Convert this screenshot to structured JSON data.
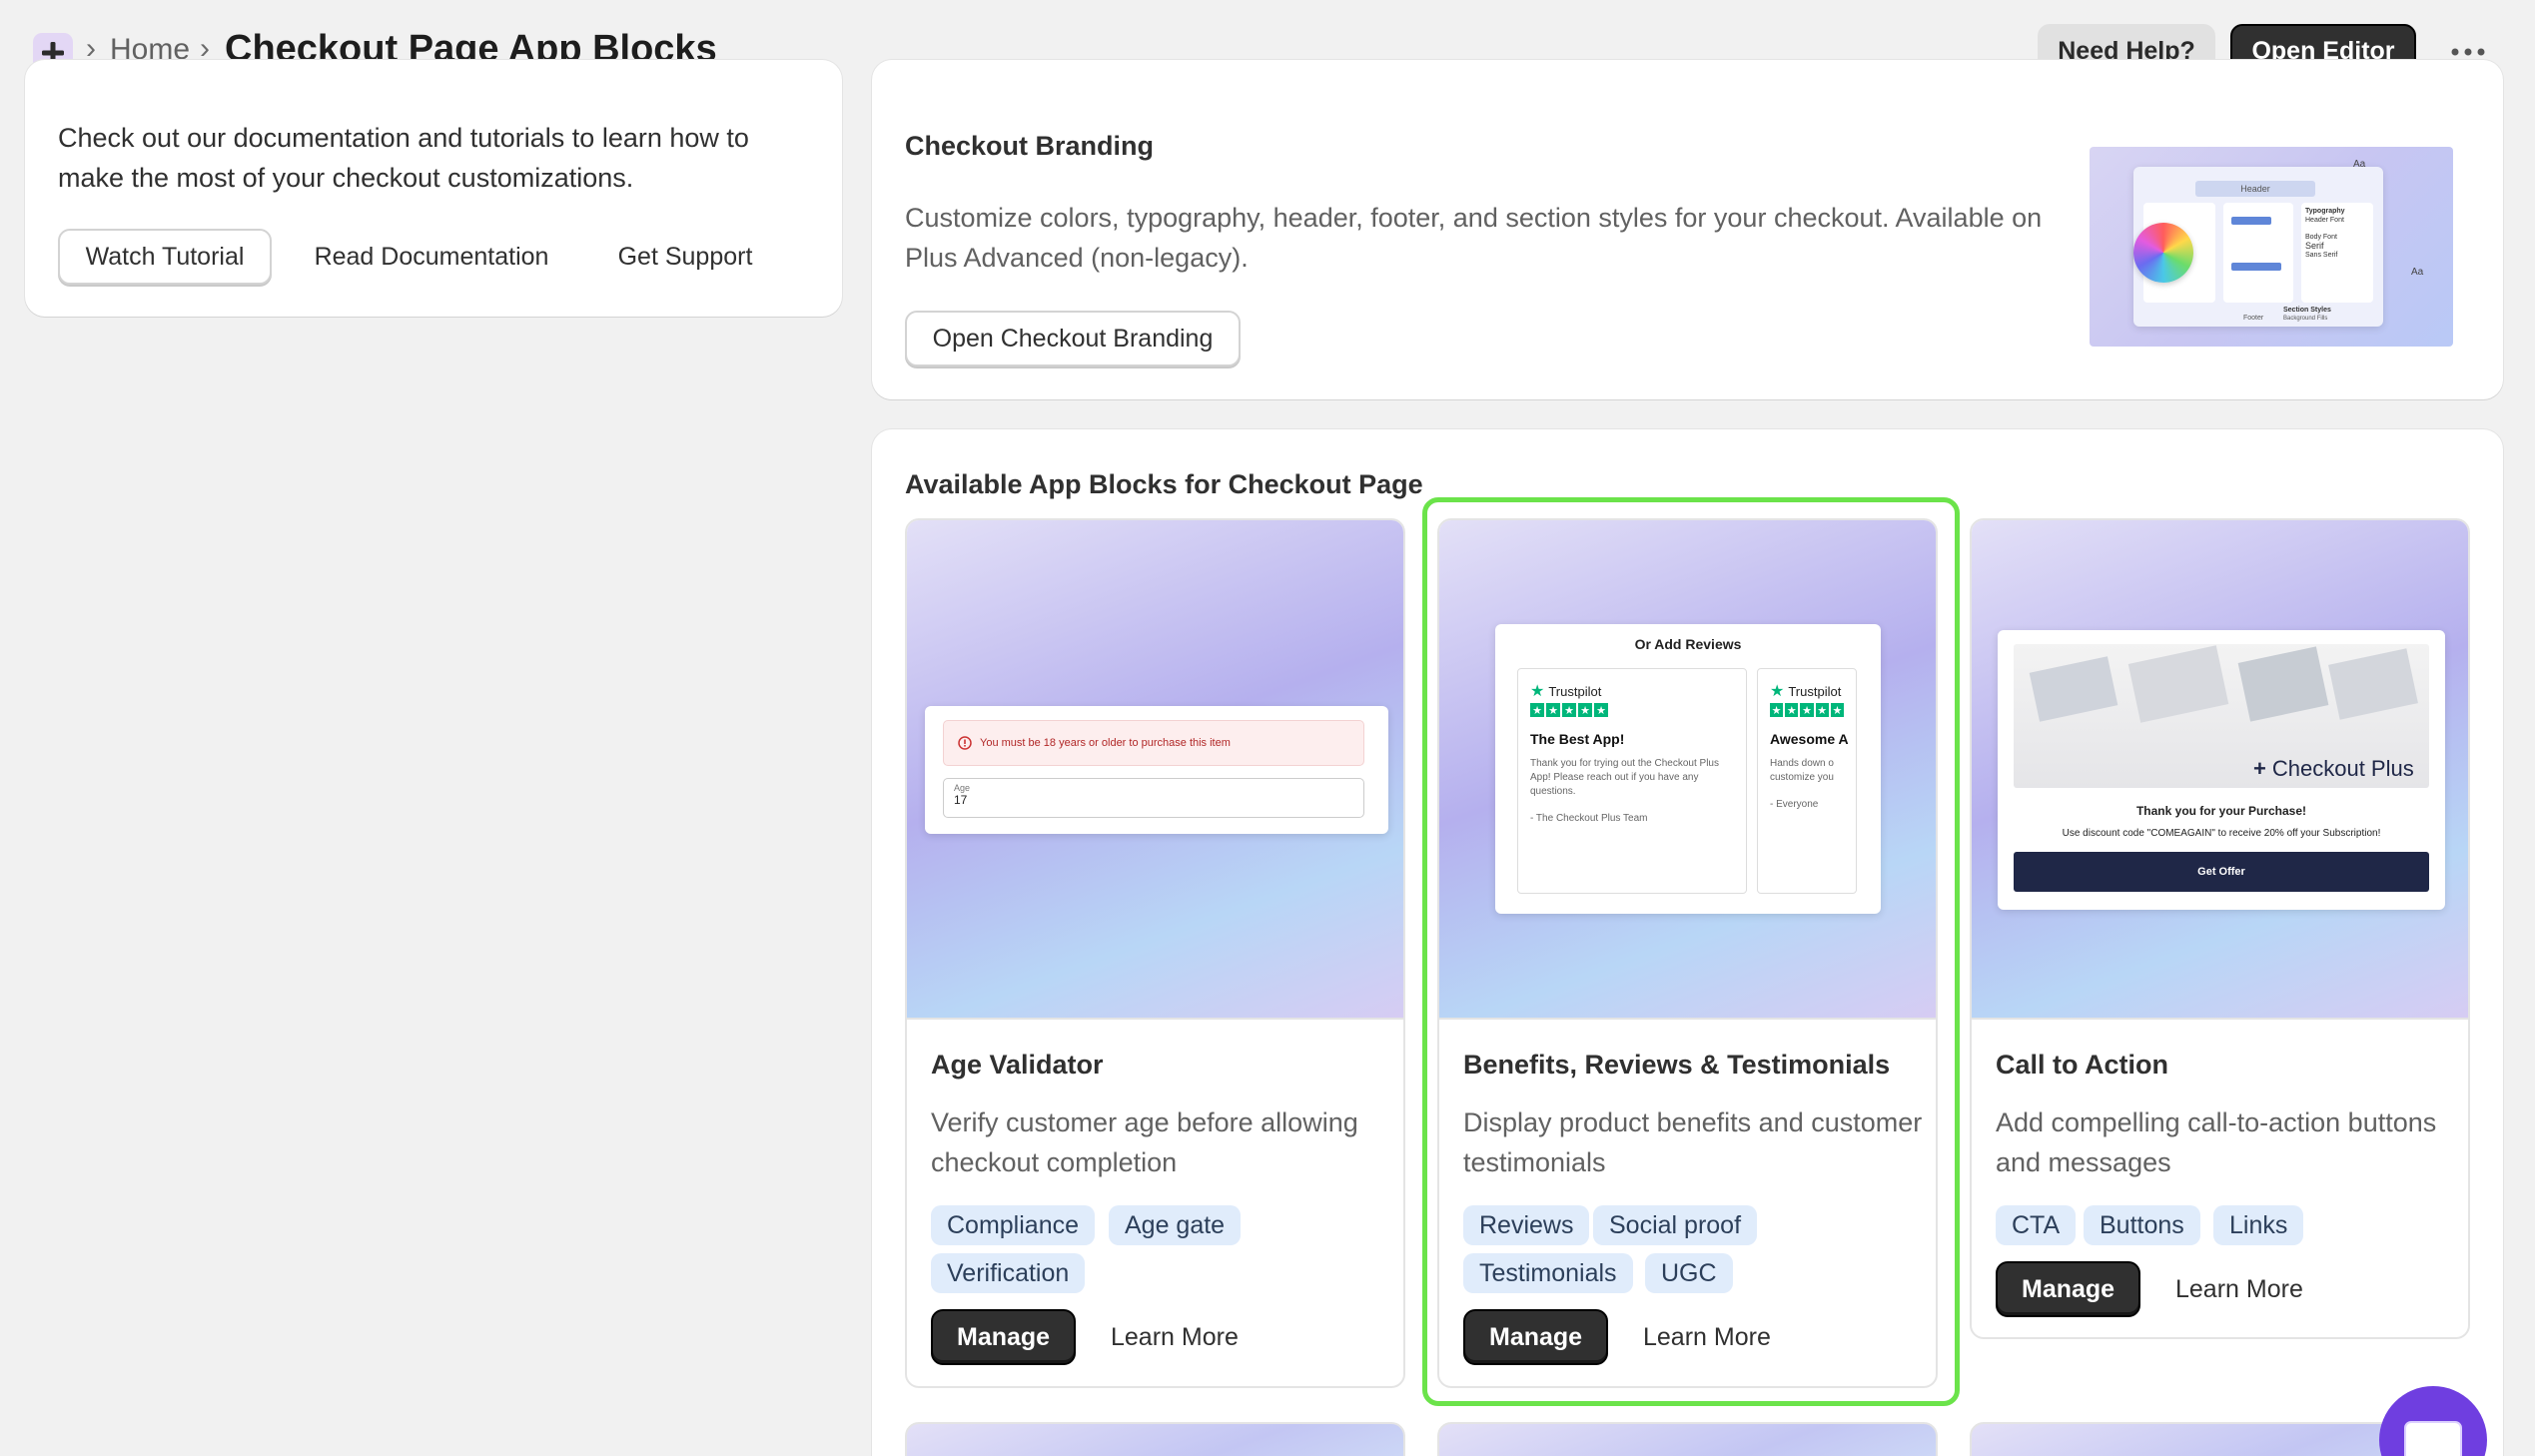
{
  "header": {
    "breadcrumb_home": "Home",
    "page_title": "Checkout Page App Blocks",
    "help_label": "Need Help?",
    "editor_label": "Open Editor"
  },
  "docs": {
    "text": "Check out our documentation and tutorials to learn how to make the most of your checkout customizations.",
    "watch_label": "Watch Tutorial",
    "read_label": "Read Documentation",
    "support_label": "Get Support"
  },
  "branding": {
    "title": "Checkout Branding",
    "description": "Customize colors, typography, header, footer, and section styles for your checkout. Available on Plus Advanced (non-legacy).",
    "button_label": "Open Checkout Branding",
    "preview": {
      "header": "Header",
      "typography": "Typography",
      "header_font": "Header Font",
      "body_font": "Body Font",
      "serif": "Serif",
      "sans_serif": "Sans Serif",
      "section_styles": "Section Styles",
      "background_fills": "Background Fills",
      "footer": "Footer",
      "aa": "Aa"
    }
  },
  "blocks": {
    "title": "Available App Blocks for Checkout Page",
    "items": [
      {
        "title": "Age Validator",
        "description": "Verify customer age before allowing checkout completion",
        "tags": [
          "Compliance",
          "Age gate",
          "Verification"
        ],
        "manage": "Manage",
        "learn": "Learn More",
        "preview": {
          "error": "You must be 18 years or older to purchase this item",
          "age_label": "Age",
          "age_value": "17"
        }
      },
      {
        "title": "Benefits, Reviews & Testimonials",
        "description": "Display product benefits and customer testimonials",
        "tags": [
          "Reviews",
          "Social proof",
          "Testimonials",
          "UGC"
        ],
        "manage": "Manage",
        "learn": "Learn More",
        "preview": {
          "heading": "Or Add Reviews",
          "brand": "Trustpilot",
          "review1_title": "The Best App!",
          "review1_body": "Thank you for trying out the Checkout Plus App! Please reach out if you have any questions.",
          "review1_author": "- The Checkout Plus Team",
          "review2_title": "Awesome A",
          "review2_body": "Hands down o customize you",
          "review2_author": "- Everyone"
        }
      },
      {
        "title": "Call to Action",
        "description": "Add compelling call-to-action buttons and messages",
        "tags": [
          "CTA",
          "Buttons",
          "Links"
        ],
        "manage": "Manage",
        "learn": "Learn More",
        "preview": {
          "brand": "Checkout Plus",
          "thanks": "Thank you for your Purchase!",
          "offer": "Use discount code \"COMEAGAIN\" to receive 20% off your Subscription!",
          "cta": "Get Offer"
        }
      }
    ]
  },
  "colors": {
    "primary_button": "#303030",
    "highlight": "#6be34a",
    "tag_bg": "#e0ecfb",
    "chat_fab": "#6f3ee0"
  }
}
